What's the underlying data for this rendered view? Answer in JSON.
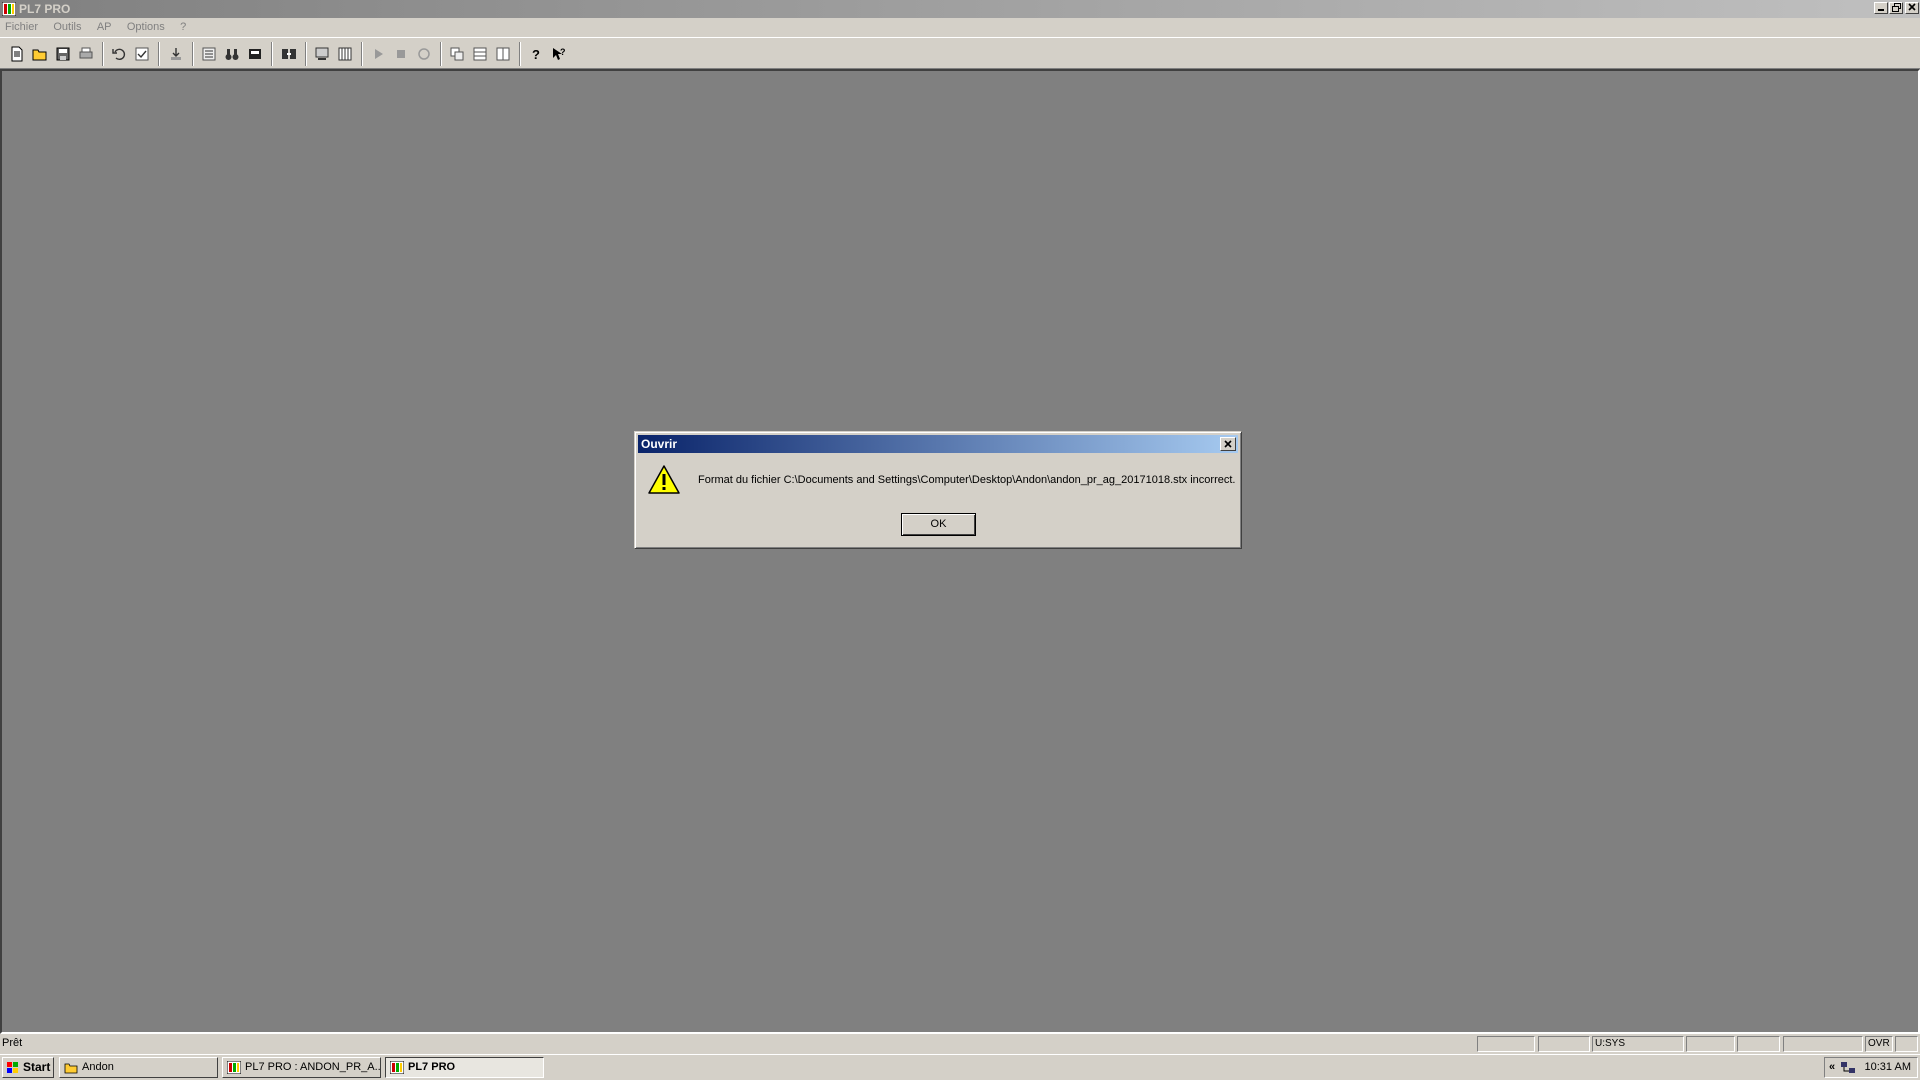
{
  "window": {
    "title": "PL7 PRO"
  },
  "menu": [
    "Fichier",
    "Outils",
    "AP",
    "Options",
    "?"
  ],
  "toolbar": {
    "buttons": [
      {
        "icon": "new-document-icon"
      },
      {
        "icon": "open-folder-icon"
      },
      {
        "icon": "save-icon"
      },
      {
        "icon": "print-icon"
      },
      {
        "icon": "undo-icon"
      },
      {
        "icon": "validate-icon"
      },
      {
        "icon": "import-icon"
      },
      {
        "icon": "list-icon"
      },
      {
        "icon": "binoculars-icon"
      },
      {
        "icon": "database-icon"
      },
      {
        "icon": "transfer-icon"
      },
      {
        "icon": "monitor-icon"
      },
      {
        "icon": "columns-icon"
      },
      {
        "icon": "run-icon"
      },
      {
        "icon": "stop-icon"
      },
      {
        "icon": "init-icon"
      },
      {
        "icon": "tile-icon"
      },
      {
        "icon": "rows-icon"
      },
      {
        "icon": "panels-icon"
      },
      {
        "icon": "help-icon"
      },
      {
        "icon": "context-help-icon"
      }
    ]
  },
  "dialog": {
    "title": "Ouvrir",
    "message": "Format du fichier C:\\Documents and Settings\\Computer\\Desktop\\Andon\\andon_pr_ag_20171018.stx incorrect.",
    "ok_label": "OK",
    "icon": "warning-icon"
  },
  "statusbar": {
    "text": "Prêt",
    "user_panel": "U:SYS",
    "mode_panel": "OVR"
  },
  "taskbar": {
    "start_label": "Start",
    "tasks": [
      {
        "label": "Andon",
        "icon": "folder-icon"
      },
      {
        "label": "PL7 PRO : ANDON_PR_A...",
        "icon": "pl7-app-icon"
      },
      {
        "label": "PL7 PRO",
        "icon": "pl7-app-icon"
      }
    ],
    "tray_chevron": "«",
    "clock": "10:31 AM"
  },
  "colors": {
    "desktop_gray": "#808080",
    "dialog_title": "#0a246a",
    "face": "#d4d0c8"
  }
}
